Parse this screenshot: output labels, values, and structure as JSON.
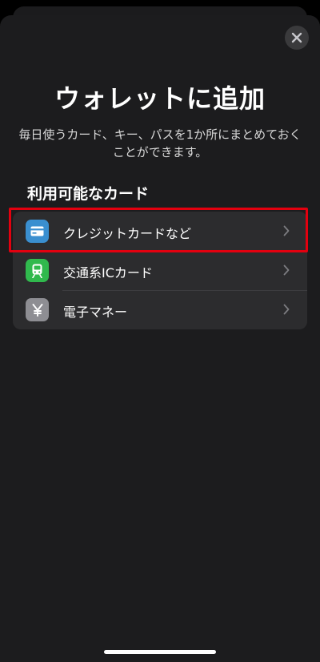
{
  "title": "ウォレットに追加",
  "subtitle": "毎日使うカード、キー、パスを1か所にまとめておくことができます。",
  "section_header": "利用可能なカード",
  "items": [
    {
      "label": "クレジットカードなど",
      "icon": "credit-card-icon",
      "icon_color": "#3a8fd0",
      "highlighted": true
    },
    {
      "label": "交通系ICカード",
      "icon": "train-icon",
      "icon_color": "#30b94d",
      "highlighted": false
    },
    {
      "label": "電子マネー",
      "icon": "yen-icon",
      "icon_color": "#8e8e93",
      "highlighted": false
    }
  ],
  "close_icon": "close-icon",
  "chevron_icon": "chevron-right-icon",
  "colors": {
    "sheet_background": "#1c1c1e",
    "list_background": "#2c2c2e",
    "highlight_border": "#e3000f"
  }
}
